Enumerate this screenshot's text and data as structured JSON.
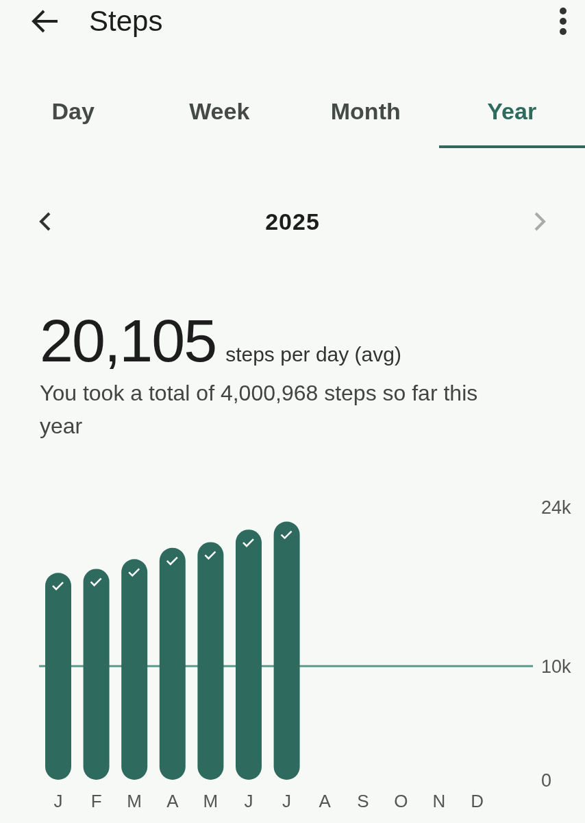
{
  "app_bar": {
    "title": "Steps"
  },
  "tabs": [
    {
      "label": "Day",
      "selected": false
    },
    {
      "label": "Week",
      "selected": false
    },
    {
      "label": "Month",
      "selected": false
    },
    {
      "label": "Year",
      "selected": true
    }
  ],
  "period_nav": {
    "label": "2025",
    "next_disabled": true
  },
  "summary": {
    "value": "20,105",
    "unit": "steps per day (avg)",
    "description": "You took a total of 4,000,968 steps so far this year"
  },
  "chart": {
    "chart_data": {
      "type": "bar",
      "categories": [
        "J",
        "F",
        "M",
        "A",
        "M",
        "J",
        "J",
        "A",
        "S",
        "O",
        "N",
        "D"
      ],
      "values": [
        18200,
        18550,
        19400,
        20400,
        20900,
        22000,
        22700,
        null,
        null,
        null,
        null,
        null
      ],
      "ylim": [
        0,
        24000
      ],
      "yticks": [
        {
          "value": 0,
          "label": "0"
        },
        {
          "value": 10000,
          "label": "10k"
        },
        {
          "value": 24000,
          "label": "24k"
        }
      ],
      "ref_lines": [
        {
          "axis": "y",
          "value": 10000
        }
      ]
    }
  }
}
